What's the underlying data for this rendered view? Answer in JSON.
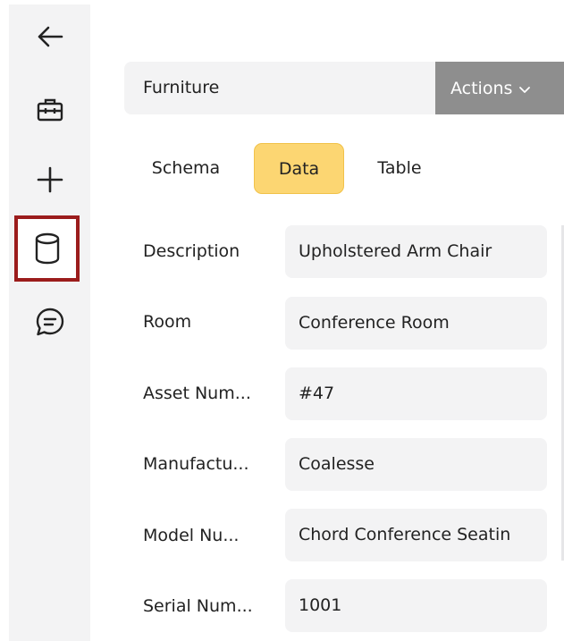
{
  "rail": {
    "items": [
      {
        "icon": "back-arrow-icon"
      },
      {
        "icon": "briefcase-icon"
      },
      {
        "icon": "plus-icon"
      },
      {
        "icon": "database-icon",
        "selected": true
      },
      {
        "icon": "chat-icon"
      }
    ],
    "selected_border_color": "#9b1c1c"
  },
  "header": {
    "title": "Furniture",
    "actions_label": "Actions"
  },
  "tabs": [
    {
      "label": "Schema",
      "active": false
    },
    {
      "label": "Data",
      "active": true
    },
    {
      "label": "Table",
      "active": false
    }
  ],
  "fields": [
    {
      "label": "Description",
      "value": "Upholstered Arm Chair"
    },
    {
      "label": "Room",
      "value": "Conference Room"
    },
    {
      "label": "Asset Num...",
      "value": "#47"
    },
    {
      "label": "Manufactu...",
      "value": "Coalesse"
    },
    {
      "label": "Model Nu...",
      "value": "Chord Conference Seatin"
    },
    {
      "label": "Serial Num...",
      "value": "1001"
    }
  ],
  "colors": {
    "active_tab": "#fcd672",
    "actions_button": "#8e8e8e",
    "panel": "#f3f3f4"
  }
}
